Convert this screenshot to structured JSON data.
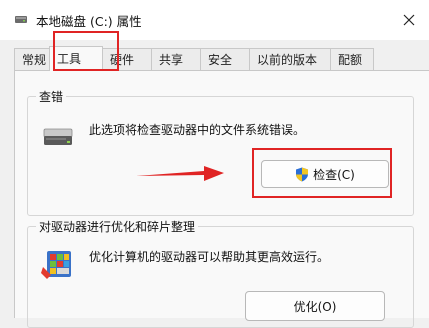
{
  "window": {
    "title": "本地磁盘 (C:) 属性",
    "close_icon": "close-icon"
  },
  "tabs": [
    {
      "label": "常规",
      "active": false
    },
    {
      "label": "工具",
      "active": true
    },
    {
      "label": "硬件",
      "active": false
    },
    {
      "label": "共享",
      "active": false
    },
    {
      "label": "安全",
      "active": false
    },
    {
      "label": "以前的版本",
      "active": false
    },
    {
      "label": "配额",
      "active": false
    }
  ],
  "error_check": {
    "legend": "查错",
    "icon": "drive-icon",
    "description": "此选项将检查驱动器中的文件系统错误。",
    "button_label": "检查(C)",
    "button_icon": "shield-icon"
  },
  "optimize": {
    "legend": "对驱动器进行优化和碎片整理",
    "icon": "defrag-icon",
    "description": "优化计算机的驱动器可以帮助其更高效运行。",
    "button_label": "优化(O)"
  },
  "colors": {
    "highlight": "#e02424",
    "shield_blue": "#2b6fd6",
    "shield_yellow": "#f3c623"
  }
}
